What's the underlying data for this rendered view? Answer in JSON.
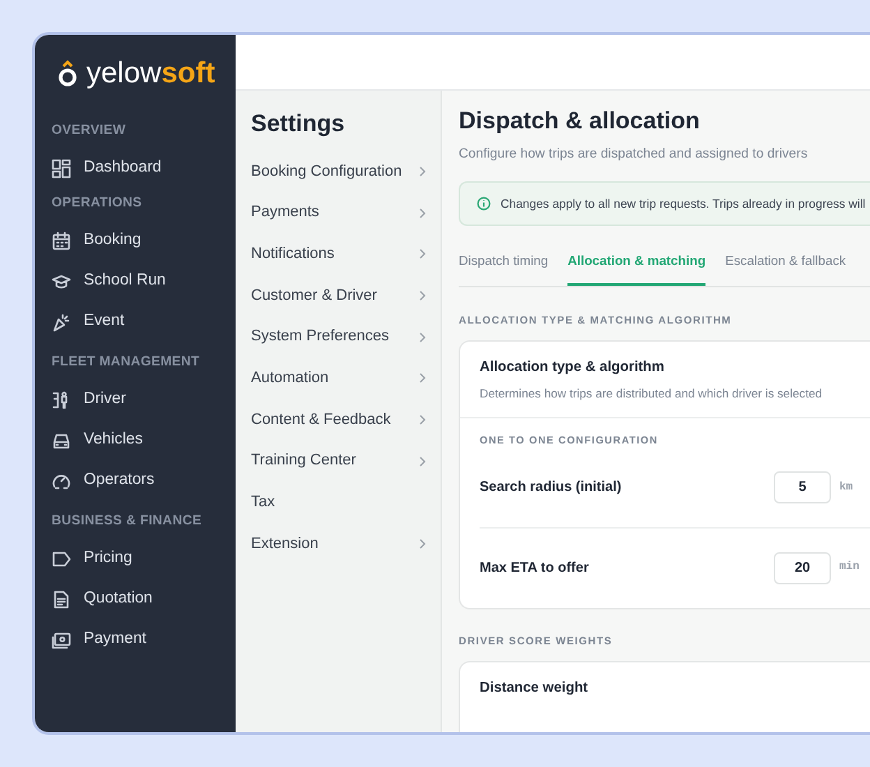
{
  "sidebar": {
    "logo": {
      "part_1": "yelow",
      "part_2": "soft"
    },
    "sections": [
      {
        "title": "OVERVIEW",
        "items": [
          {
            "label": "Dashboard"
          }
        ]
      },
      {
        "title": "OPERATIONS",
        "items": [
          {
            "label": "Booking"
          },
          {
            "label": "School Run"
          },
          {
            "label": "Event"
          }
        ]
      },
      {
        "title": "FLEET MANAGEMENT",
        "items": [
          {
            "label": "Driver"
          },
          {
            "label": "Vehicles"
          },
          {
            "label": "Operators"
          }
        ]
      },
      {
        "title": "BUSINESS & FINANCE",
        "items": [
          {
            "label": "Pricing"
          },
          {
            "label": "Quotation"
          },
          {
            "label": "Payment"
          }
        ]
      }
    ]
  },
  "settings": {
    "title": "Settings",
    "items": [
      {
        "label": "Booking Configuration",
        "has_submenu": true
      },
      {
        "label": "Payments",
        "has_submenu": true
      },
      {
        "label": "Notifications",
        "has_submenu": true
      },
      {
        "label": "Customer & Driver",
        "has_submenu": true
      },
      {
        "label": "System Preferences",
        "has_submenu": true
      },
      {
        "label": "Automation",
        "has_submenu": true
      },
      {
        "label": "Content & Feedback",
        "has_submenu": true
      },
      {
        "label": "Training Center",
        "has_submenu": true
      },
      {
        "label": "Tax",
        "has_submenu": false
      },
      {
        "label": "Extension",
        "has_submenu": true
      }
    ]
  },
  "page": {
    "title": "Dispatch & allocation",
    "subtitle": "Configure how trips are dispatched and assigned to drivers",
    "notice": "Changes apply to all new trip requests. Trips already in progress will",
    "tabs": [
      {
        "label": "Dispatch timing",
        "selected": false
      },
      {
        "label": "Allocation & matching",
        "selected": true
      },
      {
        "label": "Escalation & fallback",
        "selected": false
      }
    ],
    "sections": [
      {
        "heading": "ALLOCATION TYPE & MATCHING ALGORITHM",
        "card": {
          "title": "Allocation type & algorithm",
          "description": "Determines how trips are distributed and which driver is selected",
          "subheading": "ONE TO ONE CONFIGURATION",
          "fields": [
            {
              "label": "Search radius (initial)",
              "value": "5",
              "unit": "km"
            },
            {
              "label": "Max ETA to offer",
              "value": "20",
              "unit": "min"
            }
          ]
        }
      },
      {
        "heading": "DRIVER SCORE WEIGHTS",
        "card": {
          "title": "Distance weight"
        }
      }
    ]
  }
}
